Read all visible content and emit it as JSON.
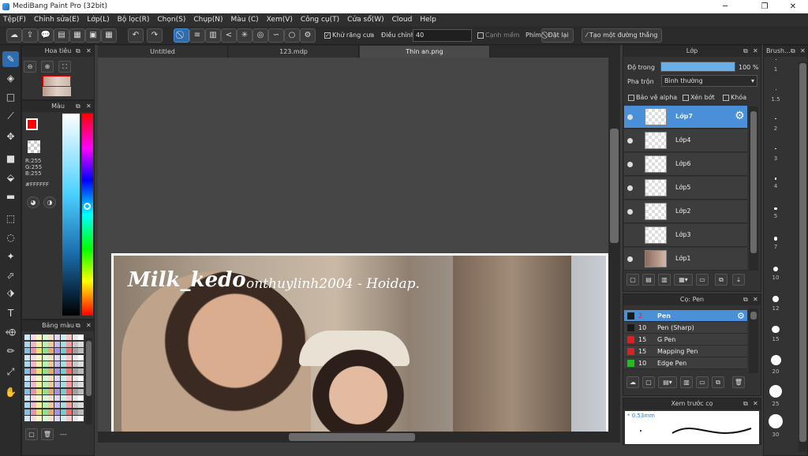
{
  "window": {
    "title": "MediBang Paint Pro (32bit)",
    "min": "─",
    "max": "❐",
    "close": "✕"
  },
  "menu": [
    "Tệp(F)",
    "Chỉnh sửa(E)",
    "Lớp(L)",
    "Bộ lọc(R)",
    "Chọn(S)",
    "Chụp(N)",
    "Màu (C)",
    "Xem(V)",
    "Công cụ(T)",
    "Cửa sổ(W)",
    "Cloud",
    "Help"
  ],
  "toolbar": {
    "antialias_label": "Khử răng cưa",
    "adjust_label": "Điều chỉnh",
    "adjust_value": "40",
    "edge_label": "Cạnh mềm",
    "key_label": "Phím",
    "reset_label": "Đặt lại",
    "line_label": "Tạo một đường thẳng"
  },
  "navigator": {
    "title": "Hoa tiêu"
  },
  "color": {
    "title": "Màu",
    "r": "R:255",
    "g": "G:255",
    "b": "B:255",
    "hex": "#FFFFFF",
    "fg": "#ff0000",
    "bg": "#ffffff"
  },
  "palette": {
    "title": "Bảng màu",
    "footer": "---"
  },
  "tabs": [
    "Untitled",
    "123.mdp",
    "Thin an.png"
  ],
  "canvas": {
    "watermark1": "Milk_kedo",
    "watermark2": "onthuylinh2004 - Hoidap."
  },
  "layers": {
    "title": "Lớp",
    "opacity_label": "Độ trong",
    "opacity_value": "100 %",
    "opacity": 1.0,
    "blend_label": "Pha trộn",
    "blend_value": "Bình thường",
    "protect_alpha": "Bảo vệ alpha",
    "clip": "Xén bớt",
    "lock": "Khóa",
    "items": [
      {
        "name": "Lớp7"
      },
      {
        "name": "Lớp4"
      },
      {
        "name": "Lớp6"
      },
      {
        "name": "Lớp5"
      },
      {
        "name": "Lớp2"
      },
      {
        "name": "Lớp3"
      },
      {
        "name": "Lớp1"
      }
    ]
  },
  "brush": {
    "title": "Cọ: Pen",
    "items": [
      {
        "size": "2",
        "name": "Pen",
        "color": "#1a1a1a"
      },
      {
        "size": "10",
        "name": "Pen (Sharp)",
        "color": "#1a1a1a"
      },
      {
        "size": "15",
        "name": "G Pen",
        "color": "#e02020"
      },
      {
        "size": "15",
        "name": "Mapping Pen",
        "color": "#e02020"
      },
      {
        "size": "10",
        "name": "Edge Pen",
        "color": "#20c020"
      }
    ]
  },
  "preview": {
    "title": "Xem trước cọ",
    "size": "0.53mm"
  },
  "brush_sizes": {
    "title": "Brush...",
    "values": [
      "1",
      "1.5",
      "2",
      "3",
      "4",
      "5",
      "7",
      "10",
      "12",
      "15",
      "20",
      "25",
      "30"
    ]
  }
}
